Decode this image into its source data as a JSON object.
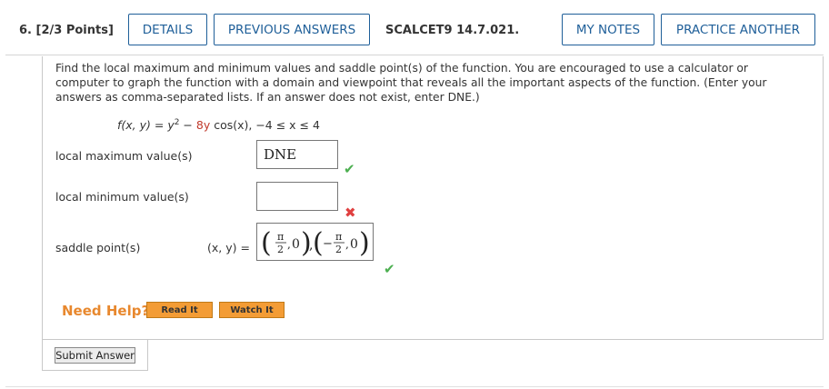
{
  "header": {
    "question_number": "6.",
    "points": "[2/3 Points]",
    "details": "DETAILS",
    "previous_answers": "PREVIOUS ANSWERS",
    "source": "SCALCET9 14.7.021.",
    "my_notes": "MY NOTES",
    "practice_another": "PRACTICE ANOTHER"
  },
  "question": {
    "prompt": "Find the local maximum and minimum values and saddle point(s) of the function. You are encouraged to use a calculator or computer to graph the function with a domain and viewpoint that reveals all the important aspects of the function. (Enter your answers as comma-separated lists. If an answer does not exist, enter DNE.)",
    "function_lhs": "f(x, y) = y",
    "function_exp": "2",
    "function_minus": " − ",
    "function_coef": "8y",
    "function_tail": " cos(x),   −4 ≤ x ≤ 4"
  },
  "answers": {
    "local_max_label": "local maximum value(s)",
    "local_max_value": "DNE",
    "local_min_label": "local minimum value(s)",
    "local_min_value": "",
    "saddle_label": "saddle point(s)",
    "saddle_prefix": "(x, y)  =",
    "saddle_pi": "π",
    "saddle_two": "2",
    "saddle_zero": "0",
    "saddle_minus": "−"
  },
  "status": {
    "correct": "✔",
    "incorrect": "✖"
  },
  "help": {
    "need_help": "Need Help?",
    "read_it": "Read It",
    "watch_it": "Watch It"
  },
  "submit": {
    "label": "Submit Answer"
  },
  "colors": {
    "link_blue": "#1f5f99",
    "correct_green": "#4caf50",
    "incorrect_red": "#e04040",
    "help_orange": "#e8882e",
    "button_orange": "#f39c35"
  }
}
